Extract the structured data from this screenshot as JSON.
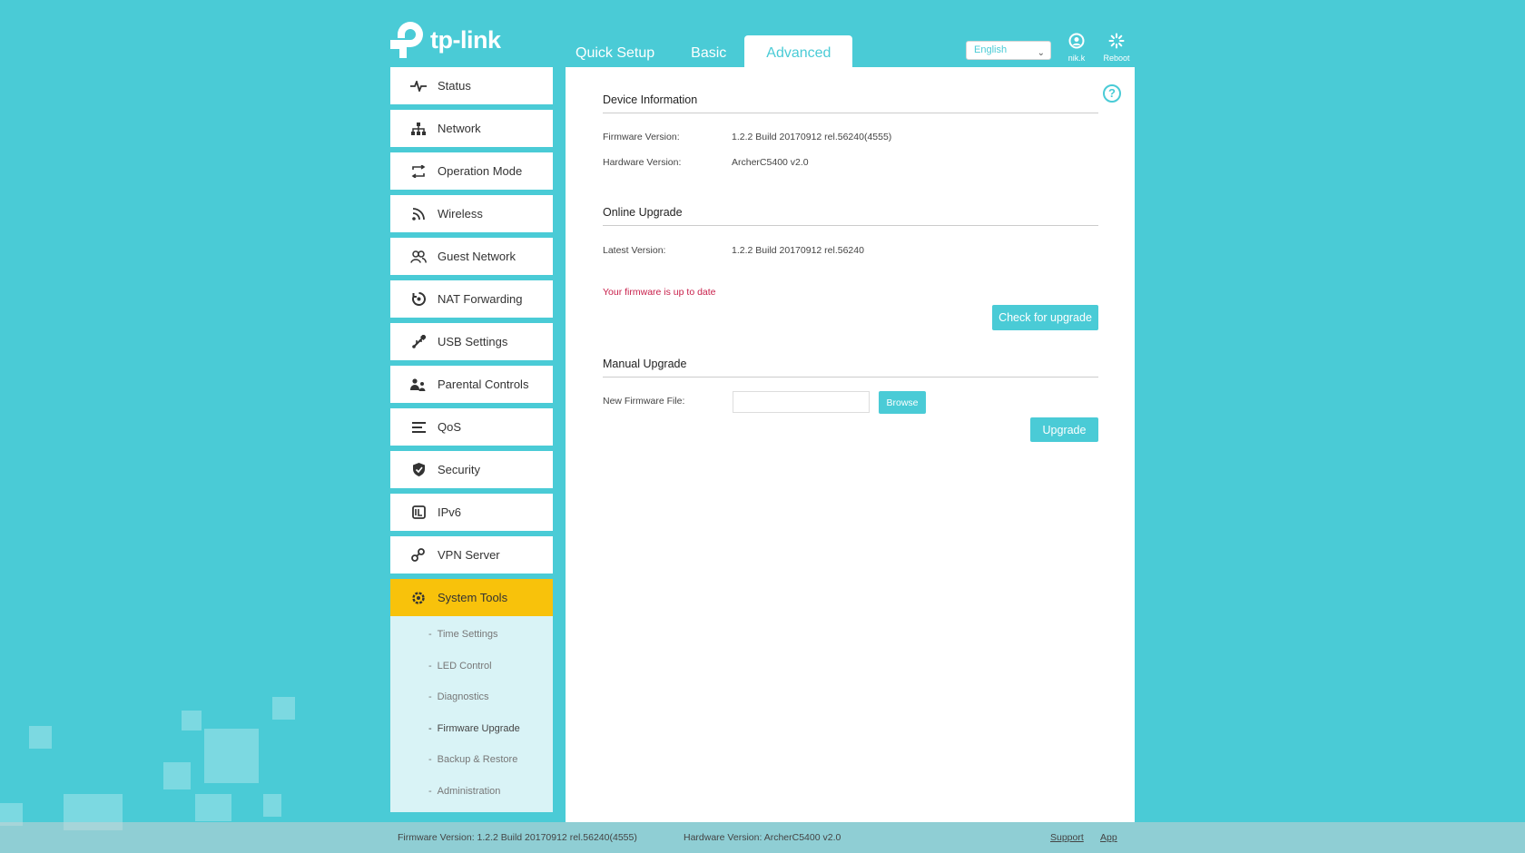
{
  "header": {
    "logo_text": "tp-link",
    "tabs": [
      {
        "label": "Quick Setup"
      },
      {
        "label": "Basic"
      },
      {
        "label": "Advanced"
      }
    ],
    "language": "English",
    "user_label": "nik.k",
    "reboot_label": "Reboot"
  },
  "sidebar": {
    "items": [
      {
        "label": "Status",
        "icon": "pulse-icon"
      },
      {
        "label": "Network",
        "icon": "network-icon"
      },
      {
        "label": "Operation Mode",
        "icon": "operation-mode-icon"
      },
      {
        "label": "Wireless",
        "icon": "wireless-icon"
      },
      {
        "label": "Guest Network",
        "icon": "guest-icon"
      },
      {
        "label": "NAT Forwarding",
        "icon": "nat-icon"
      },
      {
        "label": "USB Settings",
        "icon": "usb-icon"
      },
      {
        "label": "Parental Controls",
        "icon": "parental-icon"
      },
      {
        "label": "QoS",
        "icon": "qos-icon"
      },
      {
        "label": "Security",
        "icon": "shield-icon"
      },
      {
        "label": "IPv6",
        "icon": "ipv6-icon"
      },
      {
        "label": "VPN Server",
        "icon": "vpn-icon"
      },
      {
        "label": "System Tools",
        "icon": "gear-icon"
      }
    ],
    "submenu": [
      {
        "label": "Time Settings"
      },
      {
        "label": "LED Control"
      },
      {
        "label": "Diagnostics"
      },
      {
        "label": "Firmware Upgrade"
      },
      {
        "label": "Backup & Restore"
      },
      {
        "label": "Administration"
      }
    ]
  },
  "device_info": {
    "title": "Device Information",
    "firmware_label": "Firmware Version:",
    "firmware_value": "1.2.2 Build 20170912 rel.56240(4555)",
    "hardware_label": "Hardware Version:",
    "hardware_value": "ArcherC5400 v2.0"
  },
  "online_upgrade": {
    "title": "Online Upgrade",
    "latest_label": "Latest Version:",
    "latest_value": "1.2.2 Build 20170912 rel.56240",
    "status": "Your firmware is up to date",
    "check_button": "Check for upgrade"
  },
  "manual_upgrade": {
    "title": "Manual Upgrade",
    "file_label": "New Firmware File:",
    "file_value": "",
    "browse_button": "Browse",
    "upgrade_button": "Upgrade"
  },
  "footer": {
    "firmware": "Firmware Version: 1.2.2 Build 20170912 rel.56240(4555)",
    "hardware": "Hardware Version: ArcherC5400 v2.0",
    "support": "Support",
    "app": "App"
  },
  "colors": {
    "accent": "#4acbd6",
    "active_nav": "#f8c20b",
    "status_text": "#c8204b"
  }
}
